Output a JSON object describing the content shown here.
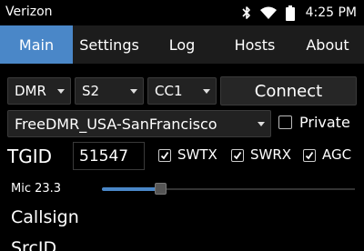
{
  "status_bar": {
    "carrier": "Verizon",
    "time": "4:25 PM",
    "icons": [
      "bluetooth-icon",
      "wifi-icon",
      "battery-icon"
    ]
  },
  "tabs": [
    {
      "label": "Main",
      "active": true
    },
    {
      "label": "Settings",
      "active": false
    },
    {
      "label": "Log",
      "active": false
    },
    {
      "label": "Hosts",
      "active": false
    },
    {
      "label": "About",
      "active": false
    }
  ],
  "controls": {
    "mode": "DMR",
    "slot": "S2",
    "color_code": "CC1",
    "connect_label": "Connect",
    "host": "FreeDMR_USA-SanFrancisco",
    "private_label": "Private",
    "private_checked": false,
    "tgid_label": "TGID",
    "tgid_value": "51547",
    "swtx_label": "SWTX",
    "swtx_checked": true,
    "swrx_label": "SWRX",
    "swrx_checked": true,
    "agc_label": "AGC",
    "agc_checked": true,
    "mic_label": "Mic 23.3",
    "mic_level_fraction": 0.23,
    "callsign_label": "Callsign",
    "srcid_label": "SrcID"
  },
  "colors": {
    "accent": "#4a87c8",
    "background": "#000000",
    "tab_bar": "#1c1c1c"
  }
}
